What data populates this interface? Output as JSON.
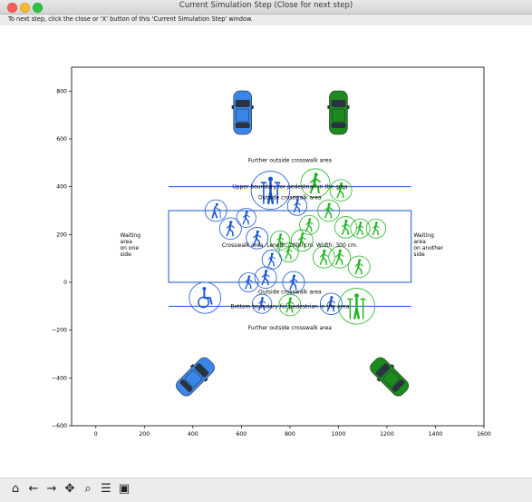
{
  "window": {
    "title": "Current Simulation Step (Close for next step)"
  },
  "instruction": "To next step, click the close or 'X' button of this 'Current Simulation Step' window.",
  "chart_data": {
    "type": "scatter",
    "xlim": [
      -100,
      1600
    ],
    "ylim": [
      -600,
      900
    ],
    "x_ticks": [
      0,
      200,
      400,
      600,
      800,
      1000,
      1200,
      1400,
      1600
    ],
    "y_ticks": [
      -600,
      -400,
      -200,
      0,
      200,
      400,
      600,
      800
    ],
    "crosswalk": {
      "x": [
        300,
        1300
      ],
      "y": [
        0,
        300
      ]
    },
    "upper_boundary_y": 400,
    "bottom_boundary_y": -100,
    "labels": {
      "further_top": "Further outside crosswalk area",
      "upper_boundary": "Upper boundary for pedestrian in the area",
      "outside_top": "Outside crosswalk area",
      "crosswalk": "Crosswalk area. Length: 1000 cm. Width: 300 cm.",
      "outside_bottom": "Outside crosswalk area",
      "bottom_boundary": "Bottom boundary for pedestrian in the area",
      "further_bottom": "Further outside crosswalk area",
      "waiting_left": [
        "Waiting",
        "area",
        "on one",
        "side"
      ],
      "waiting_right": [
        "Waiting",
        "area",
        "on another",
        "side"
      ]
    },
    "cars": [
      {
        "x": 605,
        "y": 710,
        "color": "#3a86e8",
        "angle": 0
      },
      {
        "x": 1000,
        "y": 710,
        "color": "#1c8a1c",
        "angle": 0
      },
      {
        "x": 410,
        "y": -395,
        "color": "#3a86e8",
        "angle": 45
      },
      {
        "x": 1210,
        "y": -395,
        "color": "#1c8a1c",
        "angle": -45
      }
    ],
    "pedestrians": [
      {
        "x": 720,
        "y": 385,
        "r": 80,
        "color": "#1a56d6",
        "kind": "crutches"
      },
      {
        "x": 905,
        "y": 415,
        "r": 60,
        "color": "#22b522",
        "kind": "walker"
      },
      {
        "x": 1010,
        "y": 385,
        "r": 45,
        "color": "#22b522",
        "kind": "walker"
      },
      {
        "x": 830,
        "y": 320,
        "r": 40,
        "color": "#1a56d6",
        "kind": "walker"
      },
      {
        "x": 960,
        "y": 300,
        "r": 45,
        "color": "#22b522",
        "kind": "walker"
      },
      {
        "x": 495,
        "y": 300,
        "r": 45,
        "color": "#1a56d6",
        "kind": "elder"
      },
      {
        "x": 555,
        "y": 225,
        "r": 45,
        "color": "#1a56d6",
        "kind": "walker"
      },
      {
        "x": 620,
        "y": 270,
        "r": 40,
        "color": "#1a56d6",
        "kind": "walker"
      },
      {
        "x": 880,
        "y": 240,
        "r": 40,
        "color": "#22b522",
        "kind": "walker"
      },
      {
        "x": 1030,
        "y": 230,
        "r": 45,
        "color": "#22b522",
        "kind": "walker"
      },
      {
        "x": 1090,
        "y": 225,
        "r": 40,
        "color": "#22b522",
        "kind": "walker"
      },
      {
        "x": 1155,
        "y": 225,
        "r": 40,
        "color": "#22b522",
        "kind": "walker"
      },
      {
        "x": 665,
        "y": 185,
        "r": 45,
        "color": "#1a56d6",
        "kind": "walker"
      },
      {
        "x": 760,
        "y": 175,
        "r": 40,
        "color": "#22b522",
        "kind": "walker"
      },
      {
        "x": 850,
        "y": 175,
        "r": 45,
        "color": "#22b522",
        "kind": "walker"
      },
      {
        "x": 795,
        "y": 125,
        "r": 40,
        "color": "#22b522",
        "kind": "walker"
      },
      {
        "x": 725,
        "y": 95,
        "r": 40,
        "color": "#1a56d6",
        "kind": "walker"
      },
      {
        "x": 940,
        "y": 105,
        "r": 45,
        "color": "#22b522",
        "kind": "walker"
      },
      {
        "x": 1005,
        "y": 105,
        "r": 45,
        "color": "#22b522",
        "kind": "walker"
      },
      {
        "x": 1085,
        "y": 65,
        "r": 45,
        "color": "#22b522",
        "kind": "walker"
      },
      {
        "x": 700,
        "y": 20,
        "r": 45,
        "color": "#1a56d6",
        "kind": "walker"
      },
      {
        "x": 630,
        "y": 0,
        "r": 40,
        "color": "#1a56d6",
        "kind": "walker"
      },
      {
        "x": 815,
        "y": 0,
        "r": 45,
        "color": "#1a56d6",
        "kind": "walker"
      },
      {
        "x": 450,
        "y": -65,
        "r": 65,
        "color": "#1a56d6",
        "kind": "wheelchair"
      },
      {
        "x": 685,
        "y": -90,
        "r": 40,
        "color": "#1a56d6",
        "kind": "walker"
      },
      {
        "x": 800,
        "y": -95,
        "r": 45,
        "color": "#22b522",
        "kind": "walker"
      },
      {
        "x": 970,
        "y": -90,
        "r": 45,
        "color": "#1a56d6",
        "kind": "walker"
      },
      {
        "x": 1075,
        "y": -100,
        "r": 75,
        "color": "#22b522",
        "kind": "crutches"
      }
    ]
  },
  "toolbar": {
    "home_icon": "⌂",
    "back_icon": "←",
    "forward_icon": "→",
    "pan_icon": "✥",
    "zoom_icon": "⌕",
    "config_icon": "☰",
    "save_icon": "▣"
  }
}
